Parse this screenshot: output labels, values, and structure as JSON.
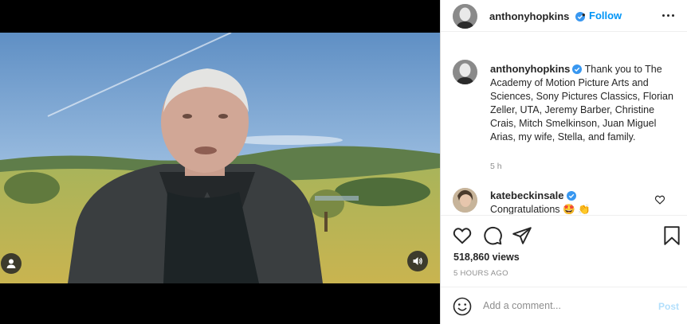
{
  "post": {
    "username": "anthonyhopkins",
    "separator": "•",
    "follow_label": "Follow",
    "more_icon": "more-options-icon",
    "verified_icon": "verified-badge-icon"
  },
  "caption": {
    "username": "anthonyhopkins",
    "text": " Thank you to The Academy of Motion Picture Arts and Sciences, Sony Pictures Classics, Florian Zeller, UTA, Jeremy Barber, Christine Crais, Mitch Smelkinson, Juan Miguel Arias, my wife, Stella, and family.",
    "time": "5 h"
  },
  "comments": [
    {
      "username": "katebeckinsale",
      "text": "Congratulations 🤩 👏"
    }
  ],
  "actions": {
    "icons": [
      "heart-icon",
      "comment-icon",
      "share-icon",
      "bookmark-icon"
    ],
    "views": "518,860 views",
    "time_ago": "5 HOURS AGO"
  },
  "add_comment": {
    "placeholder": "Add a comment...",
    "post_label": "Post",
    "emoji_icon": "emoji-icon"
  },
  "colors": {
    "link": "#0095f6",
    "verified": "#3897f0",
    "post_disabled": "#b2dffc",
    "secondary_text": "#8e8e8e"
  }
}
